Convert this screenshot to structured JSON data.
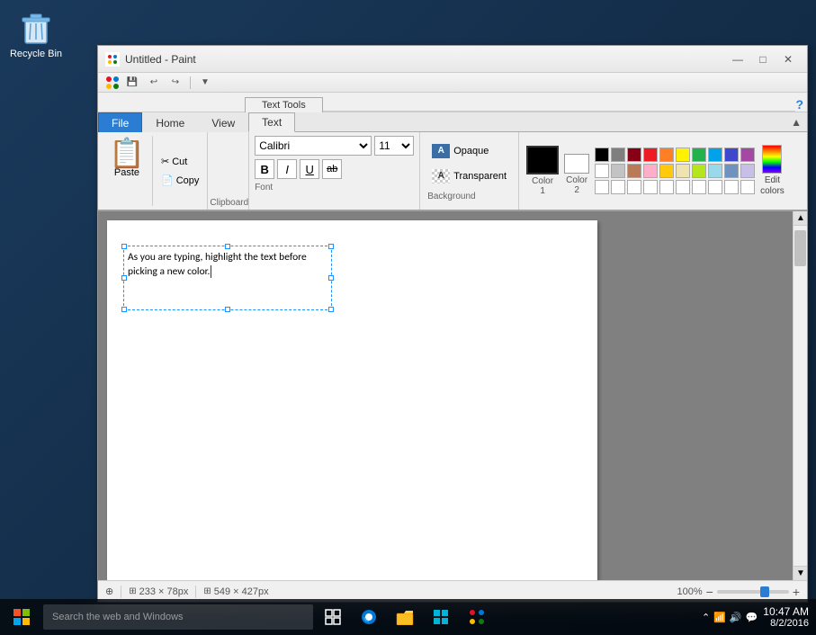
{
  "desktop": {
    "recycle_bin_label": "Recycle Bin"
  },
  "window": {
    "title": "Untitled - Paint",
    "min": "—",
    "max": "□",
    "close": "✕"
  },
  "quick_access": {
    "save": "💾",
    "undo": "↩",
    "redo": "↪",
    "separator": "|",
    "dropdown": "▼"
  },
  "ribbon": {
    "text_tools_label": "Text Tools",
    "tabs": [
      {
        "id": "file",
        "label": "File",
        "active": false,
        "is_file": true
      },
      {
        "id": "home",
        "label": "Home",
        "active": false
      },
      {
        "id": "view",
        "label": "View",
        "active": false
      },
      {
        "id": "text",
        "label": "Text",
        "active": true
      }
    ],
    "clipboard": {
      "paste_label": "Paste",
      "cut_label": "Cut",
      "copy_label": "Copy",
      "group_label": "Clipboard"
    },
    "font": {
      "family": "Calibri",
      "size": "11",
      "bold": "B",
      "italic": "I",
      "underline": "U",
      "strikethrough": "ab̶",
      "group_label": "Font"
    },
    "background": {
      "opaque_label": "Opaque",
      "transparent_label": "Transparent",
      "group_label": "Background"
    },
    "colors": {
      "color1_label": "Color\n1",
      "color2_label": "Color\n2",
      "edit_colors_label": "Edit\ncolors",
      "group_label": "Colors",
      "palette_row1": [
        "#000000",
        "#7f7f7f",
        "#880015",
        "#ed1c24",
        "#ff7f27",
        "#fff200",
        "#22b14c",
        "#00a2e8",
        "#3f48cc",
        "#a349a4"
      ],
      "palette_row2": [
        "#ffffff",
        "#c3c3c3",
        "#b97a57",
        "#ffaec9",
        "#ffc90e",
        "#efe4b0",
        "#b5e61d",
        "#99d9ea",
        "#7092be",
        "#c8bfe7"
      ],
      "palette_row3": [
        "#ffffff",
        "#ffffff",
        "#ffffff",
        "#ffffff",
        "#ffffff",
        "#ffffff",
        "#ffffff",
        "#ffffff",
        "#ffffff",
        "#ffffff"
      ]
    }
  },
  "canvas": {
    "text_content": "As you are typing, highlight the text before picking a new color.",
    "cursor_visible": true
  },
  "status_bar": {
    "size_label": "233 × 78px",
    "canvas_label": "549 × 427px",
    "zoom": "100%",
    "size_icon": "⊞",
    "canvas_icon": "⊞",
    "zoom_minus": "−",
    "zoom_plus": "+"
  },
  "taskbar": {
    "start_icon": "⊞",
    "search_placeholder": "Search the web and Windows",
    "time": "10:47 AM",
    "date": "8/2/2016"
  }
}
